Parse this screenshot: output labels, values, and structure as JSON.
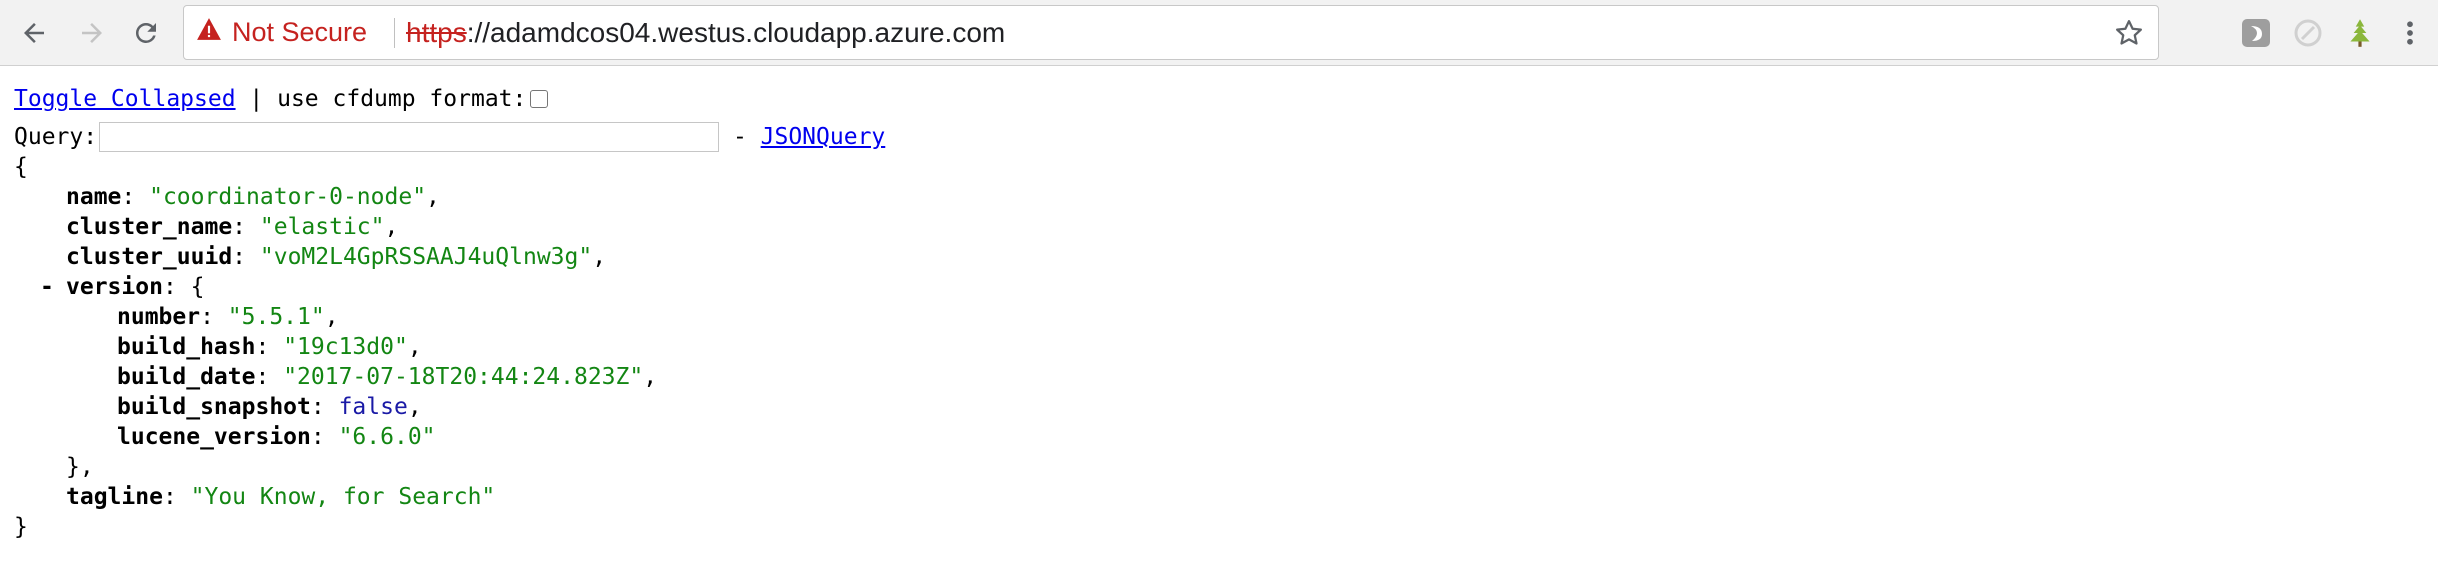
{
  "browser": {
    "security_label": "Not Secure",
    "url_scheme": "https",
    "url_rest": "://adamdcos04.westus.cloudapp.azure.com",
    "icons": {
      "back": "arrow-left-icon",
      "forward": "arrow-right-icon",
      "reload": "reload-icon",
      "warning": "warning-triangle-icon",
      "bookmark": "star-icon",
      "menu": "kebab-menu-icon"
    },
    "colors": {
      "not_secure": "#c5221f",
      "toolbar_bg": "#f2f2f2"
    }
  },
  "toolbar": {
    "toggle_label": "Toggle Collapsed",
    "separator": " | ",
    "cfdump_label": "use cfdump format:",
    "query_label": "Query:",
    "query_value": "",
    "dash": " - ",
    "jsonquery_label": "JSONQuery"
  },
  "json": {
    "open_brace": "{",
    "close_brace": "}",
    "collapse_toggle": "-",
    "name_key": "name",
    "name_value": "\"coordinator-0-node\"",
    "cluster_name_key": "cluster_name",
    "cluster_name_value": "\"elastic\"",
    "cluster_uuid_key": "cluster_uuid",
    "cluster_uuid_value": "\"voM2L4GpRSSAAJ4uQlnw3g\"",
    "version_key": "version",
    "version_open": "{",
    "version_close": "},",
    "number_key": "number",
    "number_value": "\"5.5.1\"",
    "build_hash_key": "build_hash",
    "build_hash_value": "\"19c13d0\"",
    "build_date_key": "build_date",
    "build_date_value": "\"2017-07-18T20:44:24.823Z\"",
    "build_snapshot_key": "build_snapshot",
    "build_snapshot_value": "false",
    "lucene_version_key": "lucene_version",
    "lucene_version_value": "\"6.6.0\"",
    "tagline_key": "tagline",
    "tagline_value": "\"You Know, for Search\"",
    "colors": {
      "string": "#138613",
      "boolean": "#1a1aa6",
      "link": "#0000ee"
    }
  }
}
